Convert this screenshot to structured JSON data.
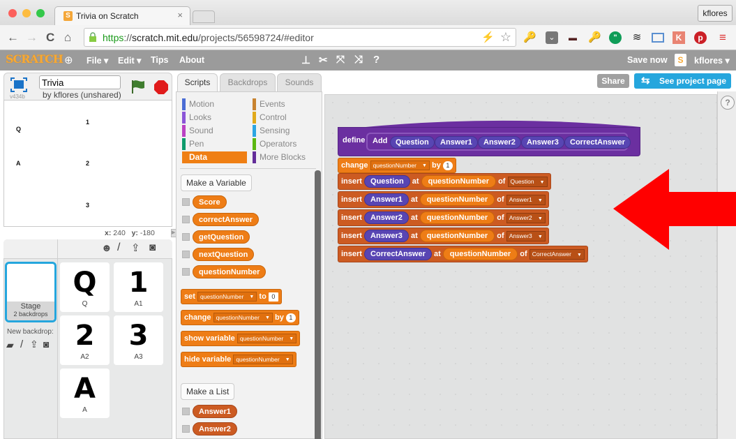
{
  "browser": {
    "tab_title": "Trivia on Scratch",
    "tab_close": "×",
    "profile_button": "kflores",
    "url": {
      "scheme": "https",
      "sep": "://",
      "host": "scratch.mit.edu",
      "path": "/projects/56598724/#editor"
    },
    "nav": {
      "back": "←",
      "forward": "→",
      "reload": "C",
      "home": "⌂"
    },
    "extensions": [
      "key-icon",
      "pocket-icon",
      "incognito-icon",
      "key-icon",
      "hangouts-icon",
      "buffer-icon",
      "screenshot-icon",
      "klout-icon",
      "pinterest-icon",
      "menu-icon"
    ]
  },
  "menubar": {
    "logo": "SCRATCH",
    "items": [
      "File ▾",
      "Edit ▾",
      "Tips",
      "About"
    ],
    "save_now": "Save now",
    "user": "kflores ▾"
  },
  "project": {
    "title": "Trivia",
    "byline": "by kflores (unshared)",
    "version": "v434b"
  },
  "stage": {
    "texts": [
      "Q",
      "1",
      "A",
      "2",
      "3"
    ],
    "coords": {
      "x_label": "x:",
      "x": "240",
      "y_label": "y:",
      "y": "-180"
    }
  },
  "sprites_panel": {
    "stage_label": "Stage",
    "stage_sub": "2 backdrops",
    "new_backdrop": "New backdrop:",
    "sprites": [
      {
        "glyph": "Q",
        "name": "Q"
      },
      {
        "glyph": "1",
        "name": "A1"
      },
      {
        "glyph": "2",
        "name": "A2"
      },
      {
        "glyph": "3",
        "name": "A3"
      },
      {
        "glyph": "A",
        "name": "A"
      }
    ]
  },
  "tabs": [
    "Scripts",
    "Backdrops",
    "Sounds"
  ],
  "categories": [
    {
      "label": "Motion",
      "color": "#4a6cd4"
    },
    {
      "label": "Looks",
      "color": "#8a55d7"
    },
    {
      "label": "Sound",
      "color": "#bb42c3"
    },
    {
      "label": "Pen",
      "color": "#0e9a6c"
    },
    {
      "label": "Data",
      "color": "#ee7d16"
    },
    {
      "label": "Events",
      "color": "#c88330"
    },
    {
      "label": "Control",
      "color": "#e1a91a"
    },
    {
      "label": "Sensing",
      "color": "#2ca5e2"
    },
    {
      "label": "Operators",
      "color": "#5cb712"
    },
    {
      "label": "More Blocks",
      "color": "#632d99"
    }
  ],
  "palette": {
    "make_variable": "Make a Variable",
    "variables": [
      "Score",
      "correctAnswer",
      "getQuestion",
      "nextQuestion",
      "questionNumber"
    ],
    "blocks": {
      "set": {
        "kw": "set",
        "var": "questionNumber",
        "to": "to",
        "val": "0"
      },
      "change": {
        "kw": "change",
        "var": "questionNumber",
        "by": "by",
        "val": "1"
      },
      "show": {
        "kw": "show variable",
        "var": "questionNumber"
      },
      "hide": {
        "kw": "hide variable",
        "var": "questionNumber"
      }
    },
    "make_list": "Make a List",
    "lists": [
      "Answer1",
      "Answer2"
    ]
  },
  "header_buttons": {
    "share": "Share",
    "see_project": "See project page"
  },
  "help": "?",
  "script": {
    "define": "define",
    "name": "Add",
    "params": [
      "Question",
      "Answer1",
      "Answer2",
      "Answer3",
      "CorrectAnswer"
    ],
    "change": {
      "kw": "change",
      "var": "questionNumber",
      "by": "by",
      "val": "1"
    },
    "inserts": [
      {
        "kw": "insert",
        "item": "Question",
        "at": "at",
        "idx": "questionNumber",
        "of": "of",
        "list": "Question"
      },
      {
        "kw": "insert",
        "item": "Answer1",
        "at": "at",
        "idx": "questionNumber",
        "of": "of",
        "list": "Answer1"
      },
      {
        "kw": "insert",
        "item": "Answer2",
        "at": "at",
        "idx": "questionNumber",
        "of": "of",
        "list": "Answer2"
      },
      {
        "kw": "insert",
        "item": "Answer3",
        "at": "at",
        "idx": "questionNumber",
        "of": "of",
        "list": "Answer3"
      },
      {
        "kw": "insert",
        "item": "CorrectAnswer",
        "at": "at",
        "idx": "questionNumber",
        "of": "of",
        "list": "CorrectAnswer"
      }
    ]
  },
  "annotation": {
    "color": "#ff0000",
    "direction": "left"
  }
}
